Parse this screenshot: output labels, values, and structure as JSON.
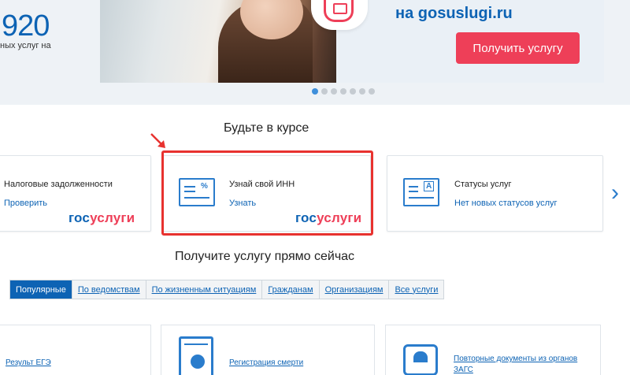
{
  "stats": {
    "number": "920",
    "caption": "ных услуг на"
  },
  "banner": {
    "text": "на gosuslugi.ru",
    "button_label": "Получить услугу",
    "dots_count": 7,
    "active_dot": 1
  },
  "section_news": {
    "title": "Будьте в курсе",
    "cards": [
      {
        "title": "Налоговые задолженности",
        "link": "Проверить",
        "logo": true
      },
      {
        "title": "Узнай свой ИНН",
        "link": "Узнать",
        "logo": true
      },
      {
        "title": "Статусы услуг",
        "link": "Нет новых статусов услуг",
        "logo": false
      }
    ]
  },
  "logo": {
    "part1": "гос",
    "part2": "услуги"
  },
  "section_services": {
    "title": "Получите услугу прямо сейчас",
    "tabs": [
      "Популярные",
      "По ведомствам",
      "По жизненным ситуациям",
      "Гражданам",
      "Организациям",
      "Все услуги"
    ],
    "active_tab": 0,
    "cards": [
      {
        "label": "Результ ЕГЭ"
      },
      {
        "label": "Регистрация смерти"
      },
      {
        "label": "Повторные документы из органов ЗАГС"
      }
    ]
  },
  "colors": {
    "brand_blue": "#0d63b4",
    "brand_red": "#ee3f58",
    "highlight_red": "#e8322f"
  }
}
